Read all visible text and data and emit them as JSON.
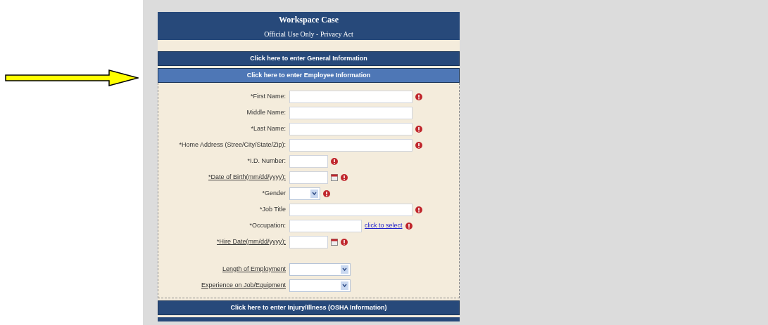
{
  "header": {
    "title": "Workspace Case",
    "subtitle": "Official Use Only - Privacy Act"
  },
  "sections_before": [
    {
      "label": "Click here to enter General Information",
      "selected": false
    },
    {
      "label": "Click here to enter Employee Information",
      "selected": true
    }
  ],
  "form": {
    "fields": [
      {
        "kind": "text",
        "label": "*First Name:",
        "required": true,
        "underlined": false
      },
      {
        "kind": "text",
        "label": "Middle Name:",
        "required": false,
        "underlined": false
      },
      {
        "kind": "text",
        "label": "*Last Name:",
        "required": true,
        "underlined": false
      },
      {
        "kind": "text",
        "label": "*Home Address (Stree/City/State/Zip):",
        "required": true,
        "underlined": false
      },
      {
        "kind": "text",
        "label": "*I.D. Number:",
        "required": true,
        "underlined": false
      },
      {
        "kind": "date",
        "label": "*Date of Birth(mm/dd/yyyy):",
        "required": true,
        "underlined": true
      },
      {
        "kind": "select",
        "label": "*Gender",
        "required": true,
        "underlined": false
      },
      {
        "kind": "text",
        "label": "*Job Title",
        "required": true,
        "underlined": false
      },
      {
        "kind": "lookup",
        "label": "*Occupation:",
        "required": true,
        "underlined": false,
        "link": "click to select"
      },
      {
        "kind": "date",
        "label": "*Hire Date(mm/dd/yyyy):",
        "required": true,
        "underlined": true
      },
      {
        "kind": "spacer"
      },
      {
        "kind": "select",
        "label": "Length of Employment",
        "required": false,
        "underlined": true
      },
      {
        "kind": "select",
        "label": "Experience on Job/Equipment",
        "required": false,
        "underlined": true
      }
    ]
  },
  "sections_after": [
    {
      "label": "Click here to enter Injury/Illness (OSHA Information)",
      "selected": false
    }
  ]
}
